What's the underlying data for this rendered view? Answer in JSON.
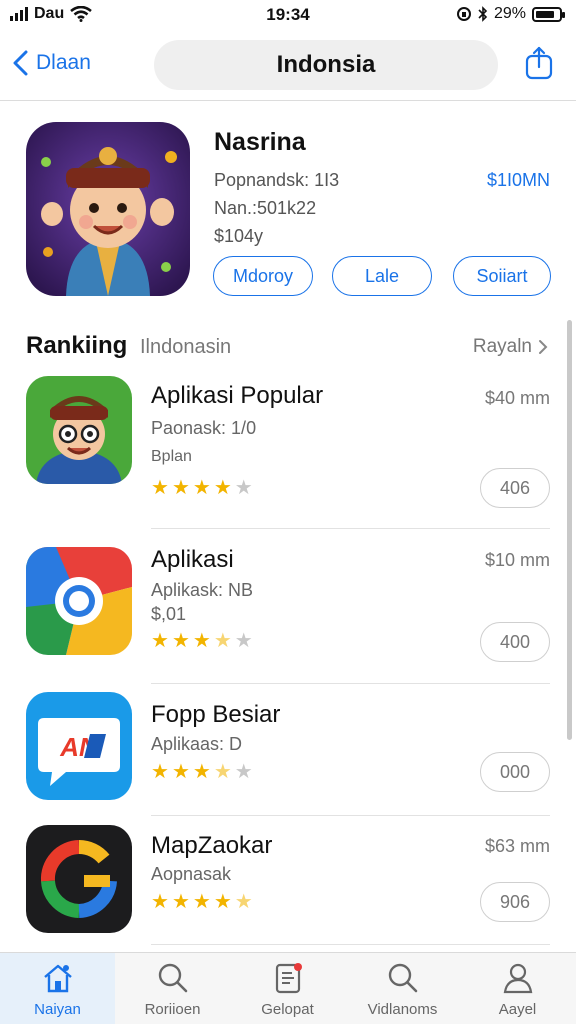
{
  "status": {
    "carrier": "Dau",
    "time": "19:34",
    "battery": "29%"
  },
  "nav": {
    "back_label": "Dlaan",
    "search_text": "Indonsia"
  },
  "featured": {
    "title": "Nasrina",
    "line1": "Popnandsk: 1I3",
    "line2": "Nan.:501k22",
    "line3": "$104y",
    "price": "$1I0MN",
    "buttons": [
      "Mdoroy",
      "Lale",
      "Soiiart"
    ]
  },
  "section": {
    "title": "Rankiing",
    "subtitle": "Ilndonasin",
    "more": "Rayaln"
  },
  "apps": [
    {
      "title": "Aplikasi Popular",
      "sub1": "Paonask: 1/0",
      "sub2": "Bplan",
      "size": "$40 mm",
      "rating": 4,
      "button": "406",
      "icon": "portrait-icon"
    },
    {
      "title": "Aplikasi",
      "sub1": "Aplikask: NB",
      "sub2": "$,01",
      "size": "$10 mm",
      "rating": 3.5,
      "button": "400",
      "icon": "browser-icon"
    },
    {
      "title": "Fopp Besiar",
      "sub1": "Aplikaas: D",
      "sub2": "",
      "size": "",
      "rating": 3.5,
      "button": "000",
      "icon": "chat-icon"
    },
    {
      "title": "MapZaokar",
      "sub1": "Aopnasak",
      "sub2": "",
      "size": "$63 mm",
      "rating": 4.5,
      "button": "906",
      "icon": "map-icon"
    }
  ],
  "tabs": [
    {
      "label": "Naiyan",
      "icon": "home-icon",
      "active": true
    },
    {
      "label": "Roriioen",
      "icon": "search-icon",
      "active": false
    },
    {
      "label": "Gelopat",
      "icon": "document-icon",
      "active": false
    },
    {
      "label": "Vidlanoms",
      "icon": "search-icon",
      "active": false
    },
    {
      "label": "Aayel",
      "icon": "profile-icon",
      "active": false
    }
  ],
  "colors": {
    "accent": "#1a73e8",
    "star": "#f2b400"
  }
}
